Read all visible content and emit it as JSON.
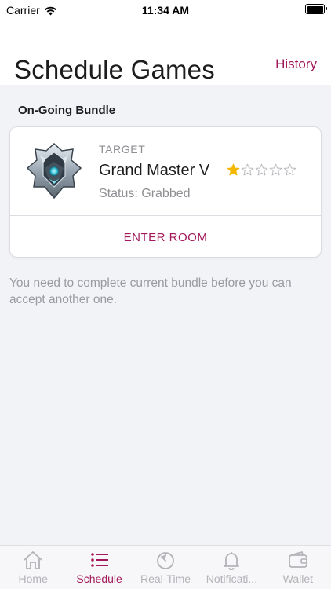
{
  "status_bar": {
    "carrier": "Carrier",
    "time": "11:34 AM",
    "wifi_icon": "wifi-icon",
    "battery_icon": "battery-full-icon"
  },
  "header": {
    "title": "Schedule Games",
    "history_label": "History"
  },
  "section": {
    "title": "On-Going Bundle"
  },
  "bundle": {
    "emblem_icon": "grandmaster-rank-emblem",
    "label": "TARGET",
    "rank_name": "Grand Master V",
    "rating_filled": 1,
    "rating_total": 5,
    "status": "Status: Grabbed",
    "enter_label": "ENTER ROOM"
  },
  "notice": "You need to complete current bundle before you can accept another one.",
  "tabs": [
    {
      "label": "Home",
      "icon": "home-icon",
      "active": false
    },
    {
      "label": "Schedule",
      "icon": "list-icon",
      "active": true
    },
    {
      "label": "Real-Time",
      "icon": "timer-icon",
      "active": false
    },
    {
      "label": "Notificati...",
      "icon": "bell-icon",
      "active": false
    },
    {
      "label": "Wallet",
      "icon": "wallet-icon",
      "active": false
    }
  ],
  "colors": {
    "accent": "#a3195b",
    "star": "#f5b800",
    "inactive_tab": "#b3b3b8",
    "background": "#f2f3f7"
  }
}
